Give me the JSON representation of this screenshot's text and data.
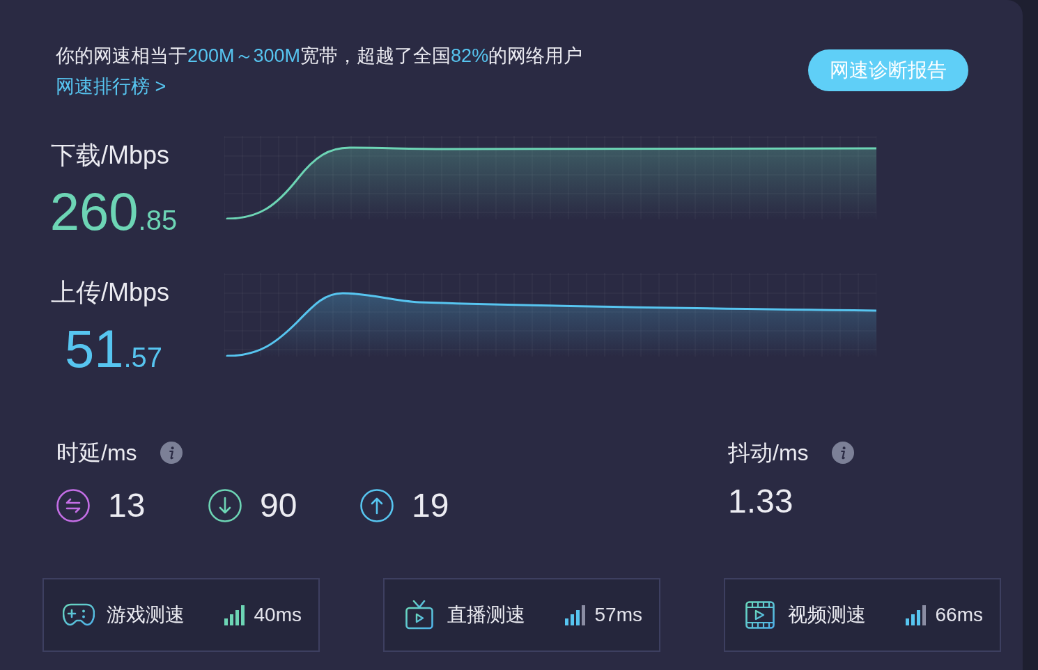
{
  "summary": {
    "segments": [
      {
        "text": "你的网速相当于",
        "highlight": false
      },
      {
        "text": "200M～300M",
        "highlight": true
      },
      {
        "text": "宽带，超越了全国",
        "highlight": false
      },
      {
        "text": "82%",
        "highlight": true
      },
      {
        "text": "的网络用户",
        "highlight": false
      }
    ]
  },
  "ranking_link": "网速排行榜 >",
  "report_button": "网速诊断报告",
  "speeds": [
    {
      "kind": "download",
      "label": "下载/Mbps",
      "integer": "260",
      "decimal": ".85",
      "color": "#6dd5b5"
    },
    {
      "kind": "upload",
      "label": "上传/Mbps",
      "integer": "51",
      "decimal": ".57",
      "color": "#57c5f0"
    }
  ],
  "latency": {
    "label": "时延/ms",
    "items": [
      {
        "kind": "idle",
        "value": "13",
        "color": "#c46ee6"
      },
      {
        "kind": "download",
        "value": "90",
        "color": "#6dd5b5"
      },
      {
        "kind": "upload",
        "value": "19",
        "color": "#57c5f0"
      }
    ]
  },
  "jitter": {
    "label": "抖动/ms",
    "value": "1.33"
  },
  "tests": [
    {
      "kind": "game",
      "label": "游戏测速",
      "value": "40ms",
      "full_signal": true,
      "color": "#6dd5b5"
    },
    {
      "kind": "live",
      "label": "直播测速",
      "value": "57ms",
      "full_signal": false,
      "color": "#57c5f0"
    },
    {
      "kind": "video",
      "label": "视频测速",
      "value": "66ms",
      "full_signal": false,
      "color": "#57c5f0"
    }
  ]
}
